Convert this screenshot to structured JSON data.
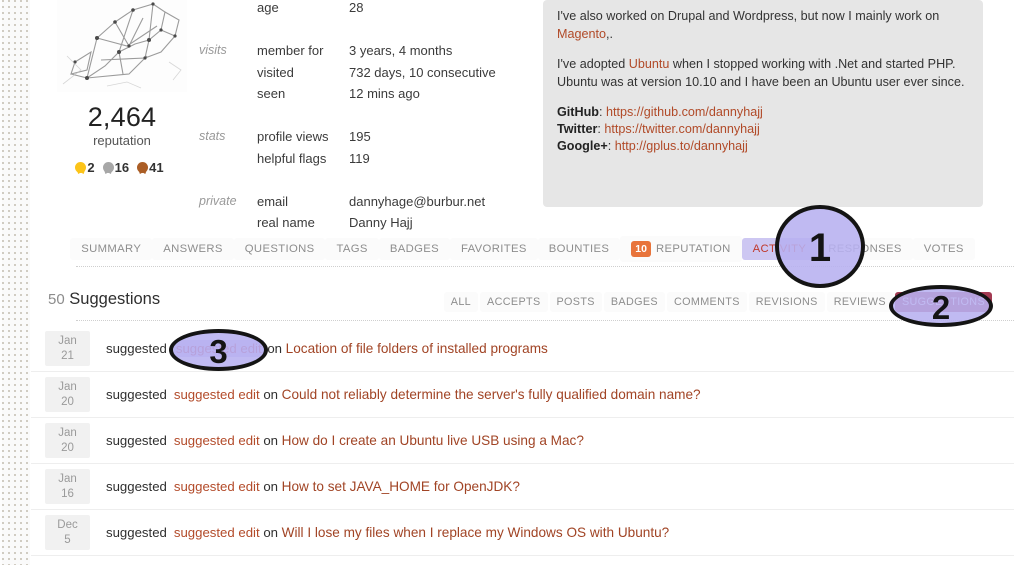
{
  "profile": {
    "avatar_alt": "user-avatar-sketch",
    "reputation": "2,464",
    "reputation_label": "reputation",
    "badges": {
      "gold": "2",
      "silver": "16",
      "bronze": "41"
    },
    "stats_rows": [
      {
        "group": "",
        "key": "age",
        "value": "28",
        "style": "normal"
      },
      {
        "group": "visits",
        "key": "member for",
        "value": "3 years, 4 months",
        "style": "muted"
      },
      {
        "group": "",
        "key": "visited",
        "value": "732 days, 10 consecutive",
        "style": "normal"
      },
      {
        "group": "",
        "key": "seen",
        "value": "12 mins ago",
        "style": "red"
      },
      {
        "group": "stats",
        "key": "profile views",
        "value": "195",
        "style": "normal"
      },
      {
        "group": "",
        "key": "helpful flags",
        "value": "119",
        "style": "orange"
      },
      {
        "group": "private",
        "key": "email",
        "value": "dannyhage@burbur.net",
        "style": "normal"
      },
      {
        "group": "",
        "key": "real name",
        "value": "Danny Hajj",
        "style": "normal"
      }
    ],
    "about": {
      "p1_before": "I've also worked on Drupal and Wordpress, but now I mainly work on ",
      "p1_link": "Magento",
      "p1_after": ",.",
      "p2_before": "I've adopted ",
      "p2_link": "Ubuntu",
      "p2_after": " when I stopped working with .Net and started PHP. Ubuntu was at version 10.10 and I have been an Ubuntu user ever since.",
      "links": [
        {
          "label": "GitHub",
          "url": "https://github.com/dannyhajj"
        },
        {
          "label": "Twitter",
          "url": "https://twitter.com/dannyhajj"
        },
        {
          "label": "Google+",
          "url": "http://gplus.to/dannyhajj"
        }
      ]
    }
  },
  "main_tabs": [
    {
      "label": "SUMMARY",
      "selected": false,
      "count": null
    },
    {
      "label": "ANSWERS",
      "selected": false,
      "count": null
    },
    {
      "label": "QUESTIONS",
      "selected": false,
      "count": null
    },
    {
      "label": "TAGS",
      "selected": false,
      "count": null
    },
    {
      "label": "BADGES",
      "selected": false,
      "count": null
    },
    {
      "label": "FAVORITES",
      "selected": false,
      "count": null
    },
    {
      "label": "BOUNTIES",
      "selected": false,
      "count": null
    },
    {
      "label": "REPUTATION",
      "selected": false,
      "count": "10"
    },
    {
      "label": "ACTIVITY",
      "selected": true,
      "count": null
    },
    {
      "label": "RESPONSES",
      "selected": false,
      "count": null
    },
    {
      "label": "VOTES",
      "selected": false,
      "count": null
    }
  ],
  "suggestions": {
    "count": "50",
    "title": "Suggestions",
    "sub_tabs": [
      {
        "label": "ALL",
        "selected": false
      },
      {
        "label": "ACCEPTS",
        "selected": false
      },
      {
        "label": "POSTS",
        "selected": false
      },
      {
        "label": "BADGES",
        "selected": false
      },
      {
        "label": "COMMENTS",
        "selected": false
      },
      {
        "label": "REVISIONS",
        "selected": false
      },
      {
        "label": "REVIEWS",
        "selected": false
      },
      {
        "label": "SUGGESTIONS",
        "selected": true
      }
    ],
    "rows": [
      {
        "month": "Jan",
        "day": "21",
        "verb": "suggested",
        "link": "suggested edit",
        "on": " on ",
        "title": "Location of file folders of installed programs",
        "highlighted": true
      },
      {
        "month": "Jan",
        "day": "20",
        "verb": "suggested",
        "link": "suggested edit",
        "on": " on ",
        "title": "Could not reliably determine the server's fully qualified domain name?",
        "highlighted": false
      },
      {
        "month": "Jan",
        "day": "20",
        "verb": "suggested",
        "link": "suggested edit",
        "on": " on ",
        "title": "How do I create an Ubuntu live USB using a Mac?",
        "highlighted": false
      },
      {
        "month": "Jan",
        "day": "16",
        "verb": "suggested",
        "link": "suggested edit",
        "on": " on ",
        "title": "How to set JAVA_HOME for OpenJDK?",
        "highlighted": false
      },
      {
        "month": "Dec",
        "day": "5",
        "verb": "suggested",
        "link": "suggested edit",
        "on": " on ",
        "title": "Will I lose my files when I replace my Windows OS with Ubuntu?",
        "highlighted": false
      }
    ]
  },
  "markers": [
    {
      "label": "1",
      "target": "activity-tab"
    },
    {
      "label": "2",
      "target": "suggestions-tab"
    },
    {
      "label": "3",
      "target": "suggested-edit-link"
    }
  ],
  "colors": {
    "accent_link": "#b14a28",
    "selected_tab_bg": "#cdc7f2",
    "selected_subtab_bg": "#a33a52",
    "rep_badge_bg": "#e8743b",
    "marker_fill": "#b7b0f0",
    "marker_border": "#141414"
  }
}
